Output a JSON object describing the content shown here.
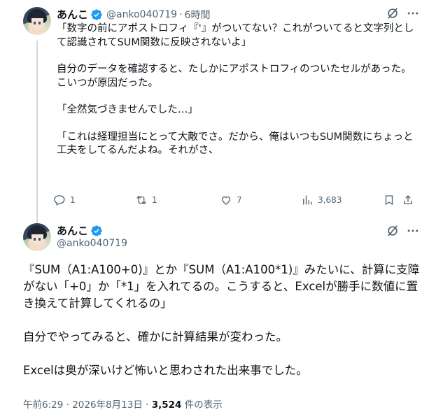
{
  "colors": {
    "accent": "#1d9bf0",
    "muted": "#536471",
    "text": "#0f1419",
    "thread_line": "#cfd9de"
  },
  "tweet1": {
    "display_name": "あんこ",
    "handle": "@anko040719",
    "dot": "·",
    "time": "6時間",
    "paragraphs": [
      "「数字の前にアポストロフィ『'』がついてない？これがついてると文字列として認識されてSUM関数に反映されないよ」",
      "自分のデータを確認すると、たしかにアポストロフィのついたセルがあった。\nこいつが原因だった。",
      "「全然気づきませんでした…」",
      "「これは経理担当にとって大敵でさ。だから、俺はいつもSUM関数にちょっと工夫をしてるんだよね。それがさ、"
    ],
    "actions": {
      "replies": "1",
      "retweets": "1",
      "likes": "7",
      "views": "3,683"
    }
  },
  "tweet2": {
    "display_name": "あんこ",
    "handle": "@anko040719",
    "paragraphs": [
      "『SUM（A1:A100+0)』とか『SUM（A1:A100*1)』みたいに、計算に支障がない「+0」か「*1」を入れてるの。こうすると、Excelが勝手に数値に置き換えて計算してくれるの」",
      "自分でやってみると、確かに計算結果が変わった。",
      "Excelは奥が深いけど怖いと思わされた出来事でした。"
    ],
    "meta": {
      "time": "午前6:29",
      "dot": "·",
      "date": "2026年8月13日",
      "dot2": "·",
      "views": "3,524",
      "views_label": "件の表示"
    }
  },
  "icons": [
    "verified-badge-icon",
    "grok-icon",
    "more-icon",
    "reply-icon",
    "retweet-icon",
    "like-icon",
    "views-icon",
    "bookmark-icon"
  ]
}
